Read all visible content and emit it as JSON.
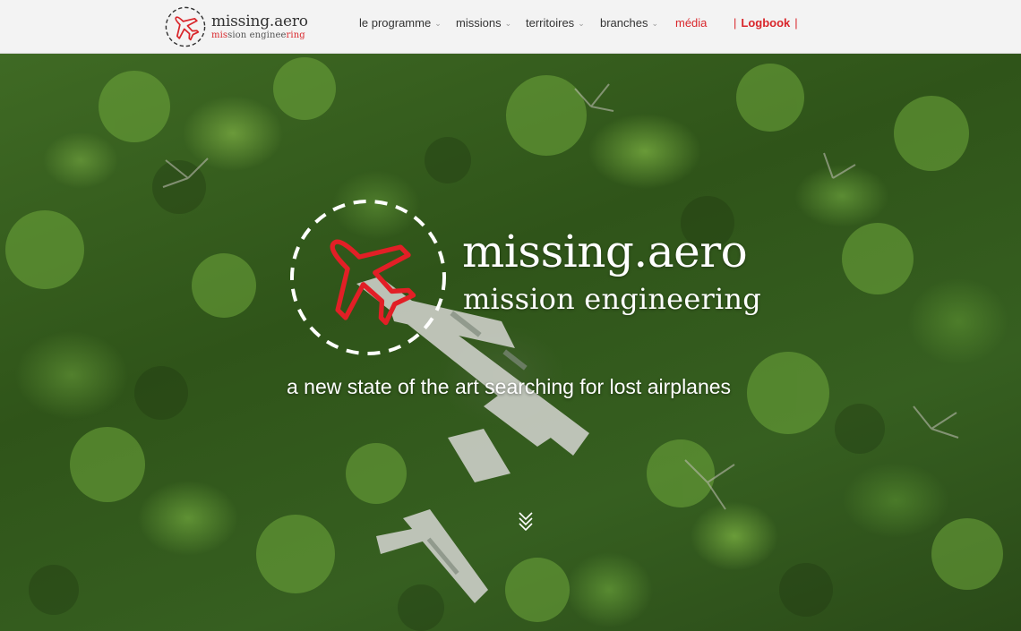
{
  "header": {
    "brand": {
      "name": "missing.aero",
      "subtitle_plain": "mission engineer",
      "subtitle_prefix": "mis",
      "subtitle_mid": "sion enginee",
      "subtitle_suffix": "ring",
      "logo_icon": "plane-circle-icon"
    },
    "nav": [
      {
        "label": "le programme",
        "has_dropdown": true
      },
      {
        "label": "missions",
        "has_dropdown": true
      },
      {
        "label": "territoires",
        "has_dropdown": true
      },
      {
        "label": "branches",
        "has_dropdown": true
      },
      {
        "label": "média",
        "has_dropdown": false
      },
      {
        "label": "Logbook",
        "has_dropdown": false
      }
    ],
    "logbook_separator": "|",
    "dropdown_icon": "chevron-down-icon"
  },
  "hero": {
    "title": "missing.aero",
    "subtitle": "mission engineering",
    "tagline": "a new state of the art searching for lost airplanes",
    "scroll_icon": "double-chevron-down-icon"
  },
  "colors": {
    "accent": "#d9262b",
    "header_bg": "#f3f3f3",
    "text_dark": "#333333",
    "hero_text": "#ffffff"
  }
}
